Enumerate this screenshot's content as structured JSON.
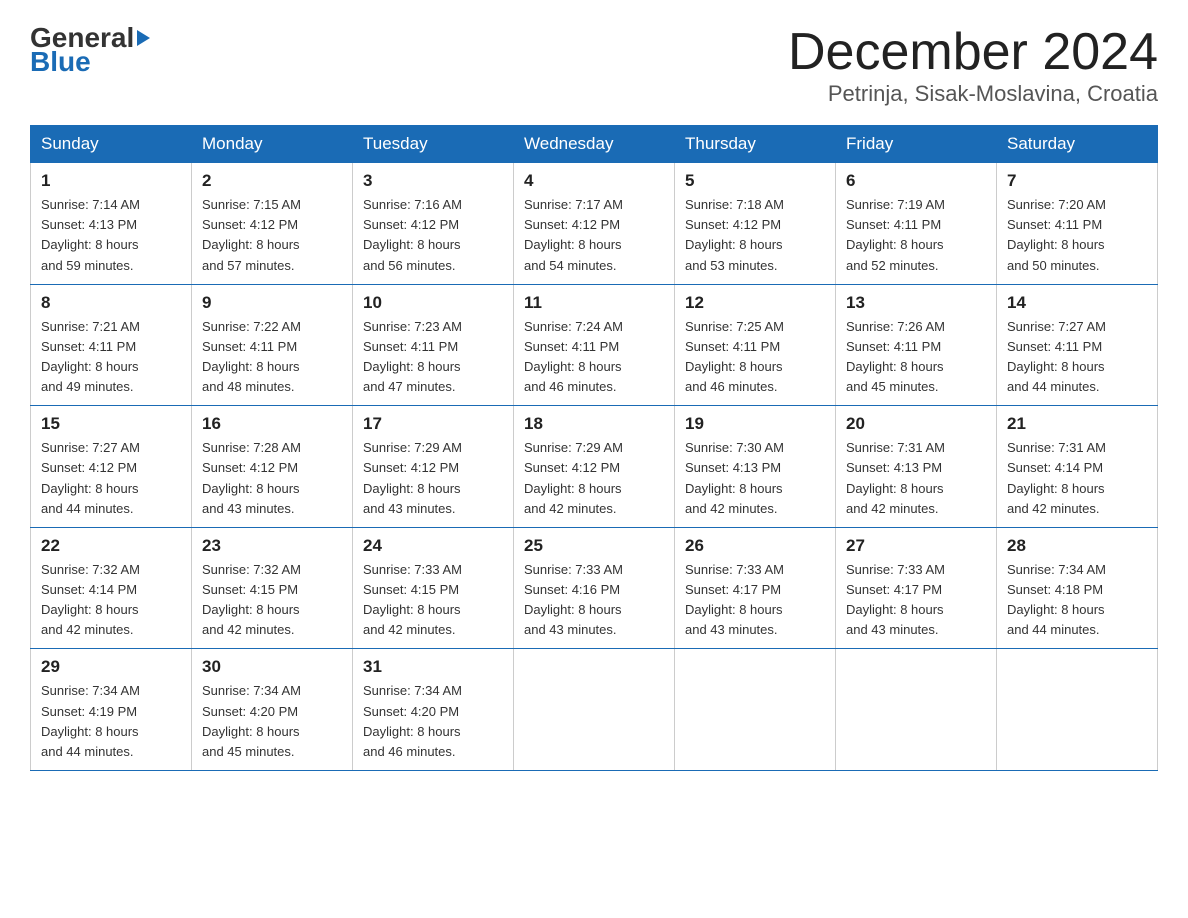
{
  "header": {
    "logo_general": "General",
    "logo_blue": "Blue",
    "title": "December 2024",
    "subtitle": "Petrinja, Sisak-Moslavina, Croatia"
  },
  "calendar": {
    "days_of_week": [
      "Sunday",
      "Monday",
      "Tuesday",
      "Wednesday",
      "Thursday",
      "Friday",
      "Saturday"
    ],
    "weeks": [
      [
        {
          "day": "1",
          "sunrise": "7:14 AM",
          "sunset": "4:13 PM",
          "daylight": "8 hours and 59 minutes."
        },
        {
          "day": "2",
          "sunrise": "7:15 AM",
          "sunset": "4:12 PM",
          "daylight": "8 hours and 57 minutes."
        },
        {
          "day": "3",
          "sunrise": "7:16 AM",
          "sunset": "4:12 PM",
          "daylight": "8 hours and 56 minutes."
        },
        {
          "day": "4",
          "sunrise": "7:17 AM",
          "sunset": "4:12 PM",
          "daylight": "8 hours and 54 minutes."
        },
        {
          "day": "5",
          "sunrise": "7:18 AM",
          "sunset": "4:12 PM",
          "daylight": "8 hours and 53 minutes."
        },
        {
          "day": "6",
          "sunrise": "7:19 AM",
          "sunset": "4:11 PM",
          "daylight": "8 hours and 52 minutes."
        },
        {
          "day": "7",
          "sunrise": "7:20 AM",
          "sunset": "4:11 PM",
          "daylight": "8 hours and 50 minutes."
        }
      ],
      [
        {
          "day": "8",
          "sunrise": "7:21 AM",
          "sunset": "4:11 PM",
          "daylight": "8 hours and 49 minutes."
        },
        {
          "day": "9",
          "sunrise": "7:22 AM",
          "sunset": "4:11 PM",
          "daylight": "8 hours and 48 minutes."
        },
        {
          "day": "10",
          "sunrise": "7:23 AM",
          "sunset": "4:11 PM",
          "daylight": "8 hours and 47 minutes."
        },
        {
          "day": "11",
          "sunrise": "7:24 AM",
          "sunset": "4:11 PM",
          "daylight": "8 hours and 46 minutes."
        },
        {
          "day": "12",
          "sunrise": "7:25 AM",
          "sunset": "4:11 PM",
          "daylight": "8 hours and 46 minutes."
        },
        {
          "day": "13",
          "sunrise": "7:26 AM",
          "sunset": "4:11 PM",
          "daylight": "8 hours and 45 minutes."
        },
        {
          "day": "14",
          "sunrise": "7:27 AM",
          "sunset": "4:11 PM",
          "daylight": "8 hours and 44 minutes."
        }
      ],
      [
        {
          "day": "15",
          "sunrise": "7:27 AM",
          "sunset": "4:12 PM",
          "daylight": "8 hours and 44 minutes."
        },
        {
          "day": "16",
          "sunrise": "7:28 AM",
          "sunset": "4:12 PM",
          "daylight": "8 hours and 43 minutes."
        },
        {
          "day": "17",
          "sunrise": "7:29 AM",
          "sunset": "4:12 PM",
          "daylight": "8 hours and 43 minutes."
        },
        {
          "day": "18",
          "sunrise": "7:29 AM",
          "sunset": "4:12 PM",
          "daylight": "8 hours and 42 minutes."
        },
        {
          "day": "19",
          "sunrise": "7:30 AM",
          "sunset": "4:13 PM",
          "daylight": "8 hours and 42 minutes."
        },
        {
          "day": "20",
          "sunrise": "7:31 AM",
          "sunset": "4:13 PM",
          "daylight": "8 hours and 42 minutes."
        },
        {
          "day": "21",
          "sunrise": "7:31 AM",
          "sunset": "4:14 PM",
          "daylight": "8 hours and 42 minutes."
        }
      ],
      [
        {
          "day": "22",
          "sunrise": "7:32 AM",
          "sunset": "4:14 PM",
          "daylight": "8 hours and 42 minutes."
        },
        {
          "day": "23",
          "sunrise": "7:32 AM",
          "sunset": "4:15 PM",
          "daylight": "8 hours and 42 minutes."
        },
        {
          "day": "24",
          "sunrise": "7:33 AM",
          "sunset": "4:15 PM",
          "daylight": "8 hours and 42 minutes."
        },
        {
          "day": "25",
          "sunrise": "7:33 AM",
          "sunset": "4:16 PM",
          "daylight": "8 hours and 43 minutes."
        },
        {
          "day": "26",
          "sunrise": "7:33 AM",
          "sunset": "4:17 PM",
          "daylight": "8 hours and 43 minutes."
        },
        {
          "day": "27",
          "sunrise": "7:33 AM",
          "sunset": "4:17 PM",
          "daylight": "8 hours and 43 minutes."
        },
        {
          "day": "28",
          "sunrise": "7:34 AM",
          "sunset": "4:18 PM",
          "daylight": "8 hours and 44 minutes."
        }
      ],
      [
        {
          "day": "29",
          "sunrise": "7:34 AM",
          "sunset": "4:19 PM",
          "daylight": "8 hours and 44 minutes."
        },
        {
          "day": "30",
          "sunrise": "7:34 AM",
          "sunset": "4:20 PM",
          "daylight": "8 hours and 45 minutes."
        },
        {
          "day": "31",
          "sunrise": "7:34 AM",
          "sunset": "4:20 PM",
          "daylight": "8 hours and 46 minutes."
        },
        null,
        null,
        null,
        null
      ]
    ],
    "labels": {
      "sunrise": "Sunrise: ",
      "sunset": "Sunset: ",
      "daylight": "Daylight: "
    }
  }
}
